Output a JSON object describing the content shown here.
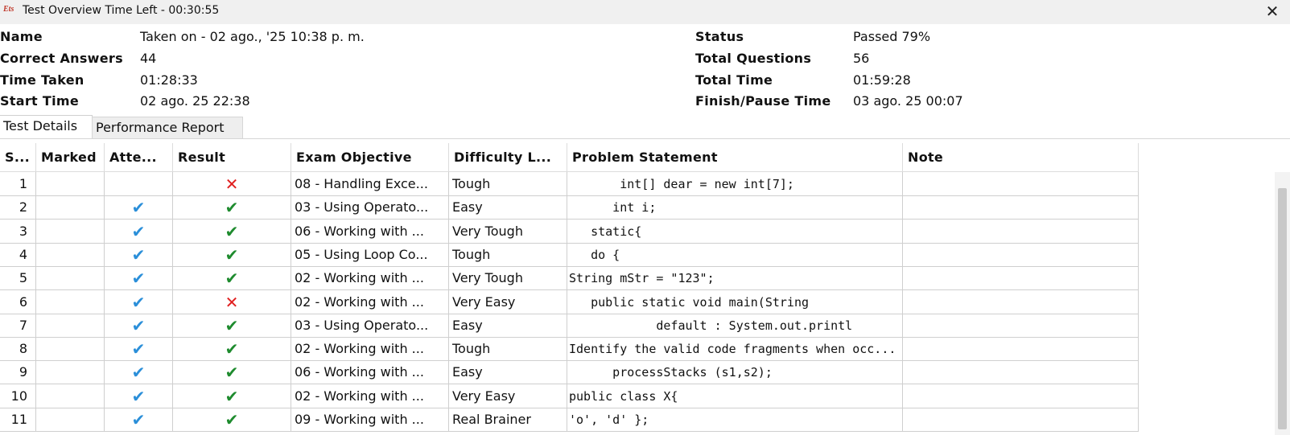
{
  "window": {
    "logo": "Ets",
    "title": "Test Overview   Time Left - 00:30:55",
    "close_icon": "close-icon"
  },
  "summary": {
    "left": [
      {
        "label": "Name",
        "value": "Taken on - 02 ago., '25 10:38 p. m."
      },
      {
        "label": "Correct Answers",
        "value": "44"
      },
      {
        "label": "Time Taken",
        "value": "01:28:33"
      },
      {
        "label": "Start Time",
        "value": "02 ago. 25 22:38"
      }
    ],
    "right": [
      {
        "label": "Status",
        "value": "Passed 79%"
      },
      {
        "label": "Total Questions",
        "value": "56"
      },
      {
        "label": "Total Time",
        "value": "01:59:28"
      },
      {
        "label": "Finish/Pause Time",
        "value": "03 ago. 25 00:07"
      }
    ]
  },
  "tabs": [
    {
      "label": "Test Details",
      "active": true
    },
    {
      "label": "Performance Report",
      "active": false
    }
  ],
  "table": {
    "headers": [
      "S...",
      "Marked",
      "Atte...",
      "Result",
      "Exam Objective",
      "Difficulty L...",
      "Problem Statement",
      "Note"
    ],
    "rows": [
      {
        "sn": "1",
        "marked": "",
        "attempted": false,
        "result": "wrong",
        "objective": "08 - Handling Exce...",
        "difficulty": "Tough",
        "problem": "       int[] dear = new int[7];",
        "note": ""
      },
      {
        "sn": "2",
        "marked": "",
        "attempted": true,
        "result": "correct",
        "objective": "03 - Using Operato...",
        "difficulty": "Easy",
        "problem": "      int i;",
        "note": ""
      },
      {
        "sn": "3",
        "marked": "",
        "attempted": true,
        "result": "correct",
        "objective": "06 - Working with ...",
        "difficulty": "Very Tough",
        "problem": "   static{",
        "note": ""
      },
      {
        "sn": "4",
        "marked": "",
        "attempted": true,
        "result": "correct",
        "objective": "05 - Using Loop Co...",
        "difficulty": "Tough",
        "problem": "   do {",
        "note": ""
      },
      {
        "sn": "5",
        "marked": "",
        "attempted": true,
        "result": "correct",
        "objective": "02 - Working with ...",
        "difficulty": "Very Tough",
        "problem": "String mStr = \"123\";",
        "note": ""
      },
      {
        "sn": "6",
        "marked": "",
        "attempted": true,
        "result": "wrong",
        "objective": "02 - Working with ...",
        "difficulty": "Very Easy",
        "problem": "   public static void main(String",
        "note": ""
      },
      {
        "sn": "7",
        "marked": "",
        "attempted": true,
        "result": "correct",
        "objective": "03 - Using Operato...",
        "difficulty": "Easy",
        "problem": "            default : System.out.printl",
        "note": ""
      },
      {
        "sn": "8",
        "marked": "",
        "attempted": true,
        "result": "correct",
        "objective": "02 - Working with ...",
        "difficulty": "Tough",
        "problem": "Identify the valid code fragments when occ...",
        "note": ""
      },
      {
        "sn": "9",
        "marked": "",
        "attempted": true,
        "result": "correct",
        "objective": "06 - Working with ...",
        "difficulty": "Easy",
        "problem": "      processStacks (s1,s2);",
        "note": ""
      },
      {
        "sn": "10",
        "marked": "",
        "attempted": true,
        "result": "correct",
        "objective": "02 - Working with ...",
        "difficulty": "Very Easy",
        "problem": "public class X{",
        "note": ""
      },
      {
        "sn": "11",
        "marked": "",
        "attempted": true,
        "result": "correct",
        "objective": "09 - Working with ...",
        "difficulty": "Real Brainer",
        "problem": "'o', 'd' };",
        "note": ""
      }
    ]
  },
  "icons": {
    "attempted": "checkmark-blue-icon",
    "correct": "checkmark-green-icon",
    "wrong": "cross-red-icon"
  },
  "colors": {
    "correct": "#1e8b2e",
    "wrong": "#e02020",
    "attempted": "#2b8fd9"
  }
}
